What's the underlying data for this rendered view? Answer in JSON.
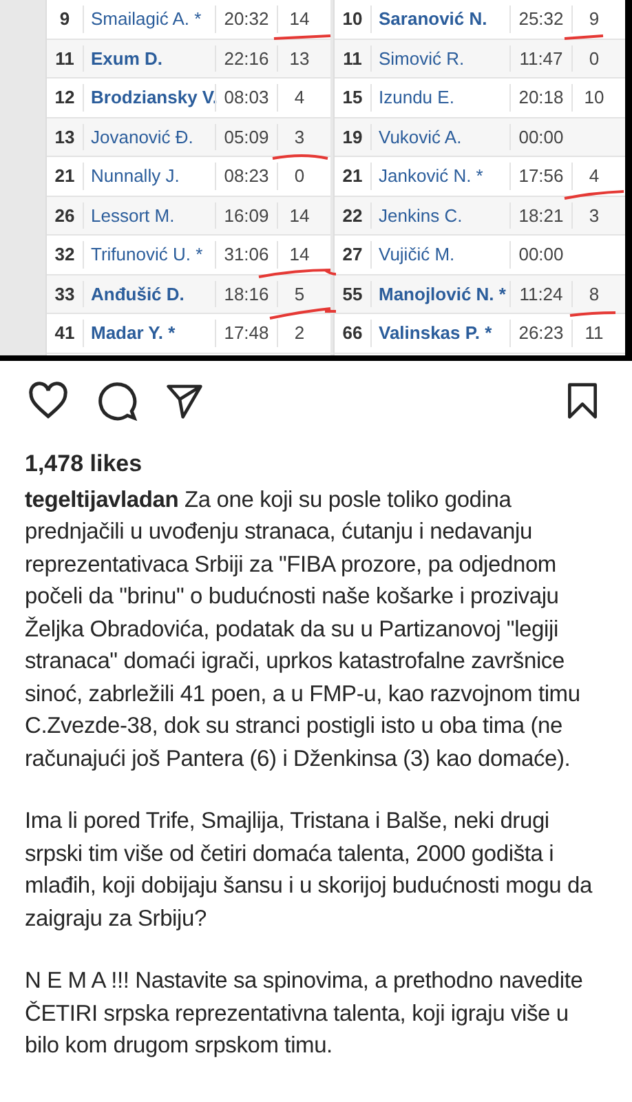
{
  "post_image": {
    "tables": [
      {
        "rows": [
          {
            "number": "9",
            "name": "Smailagić A. *",
            "time": "20:32",
            "points": "14",
            "bold": false
          },
          {
            "number": "11",
            "name": "Exum D.",
            "time": "22:16",
            "points": "13",
            "bold": true
          },
          {
            "number": "12",
            "name": "Brodziansky V.",
            "time": "08:03",
            "points": "4",
            "bold": true
          },
          {
            "number": "13",
            "name": "Jovanović Đ.",
            "time": "05:09",
            "points": "3",
            "bold": false
          },
          {
            "number": "21",
            "name": "Nunnally J.",
            "time": "08:23",
            "points": "0",
            "bold": false
          },
          {
            "number": "26",
            "name": "Lessort M.",
            "time": "16:09",
            "points": "14",
            "bold": false
          },
          {
            "number": "32",
            "name": "Trifunović U. *",
            "time": "31:06",
            "points": "14",
            "bold": false
          },
          {
            "number": "33",
            "name": "Anđušić D.",
            "time": "18:16",
            "points": "5",
            "bold": true
          },
          {
            "number": "41",
            "name": "Madar Y. *",
            "time": "17:48",
            "points": "2",
            "bold": true
          }
        ]
      },
      {
        "rows": [
          {
            "number": "10",
            "name": "Saranović N.",
            "time": "25:32",
            "points": "9",
            "bold": true
          },
          {
            "number": "11",
            "name": "Simović R.",
            "time": "11:47",
            "points": "0",
            "bold": false
          },
          {
            "number": "15",
            "name": "Izundu E.",
            "time": "20:18",
            "points": "10",
            "bold": false
          },
          {
            "number": "19",
            "name": "Vuković A.",
            "time": "00:00",
            "bold": false
          },
          {
            "number": "21",
            "name": "Janković N. *",
            "time": "17:56",
            "points": "4",
            "bold": false
          },
          {
            "number": "22",
            "name": "Jenkins C.",
            "time": "18:21",
            "points": "3",
            "bold": false
          },
          {
            "number": "27",
            "name": "Vujičić M.",
            "time": "00:00",
            "bold": false
          },
          {
            "number": "55",
            "name": "Manojlović N. *",
            "time": "11:24",
            "points": "8",
            "bold": true
          },
          {
            "number": "66",
            "name": "Valinskas P. *",
            "time": "26:23",
            "points": "11",
            "bold": true
          }
        ]
      }
    ]
  },
  "likes": "1,478 likes",
  "caption": [
    "**tegeltijavladan** Za one koji su posle toliko godina prednjačili u uvođenju stranaca, ćutanju i nedavanju reprezentativaca Srbiji za \"FIBA prozore, pa odjednom počeli da \"brinu\" o budućnosti naše košarke i prozivaju Željka Obradovića, podatak da su u Partizanovoj \"legiji stranaca\" domaći igrači, uprkos katastrofalne završnice sinoć, zabrležili 41 poen, a u FMP-u, kao razvojnom timu C.Zvezde-38, dok su stranci postigli isto u oba tima (ne računajući još Pantera (6) i Dženkinsa (3) kao domaće).",
    "Ima li pored Trife, Smajlija, Tristana i Balše, neki drugi srpski tim  više od četiri domaća talenta, 2000 godišta i mlađih, koji dobijaju šansu i u skorijoj budućnosti mogu da zaigraju za Srbiju?",
    "N E M A !!! Nastavite sa spinovima, a prethodno navedite ČETIRI srpska reprezentativna talenta, koji igraju više u bilo kom drugom srpskom timu."
  ]
}
